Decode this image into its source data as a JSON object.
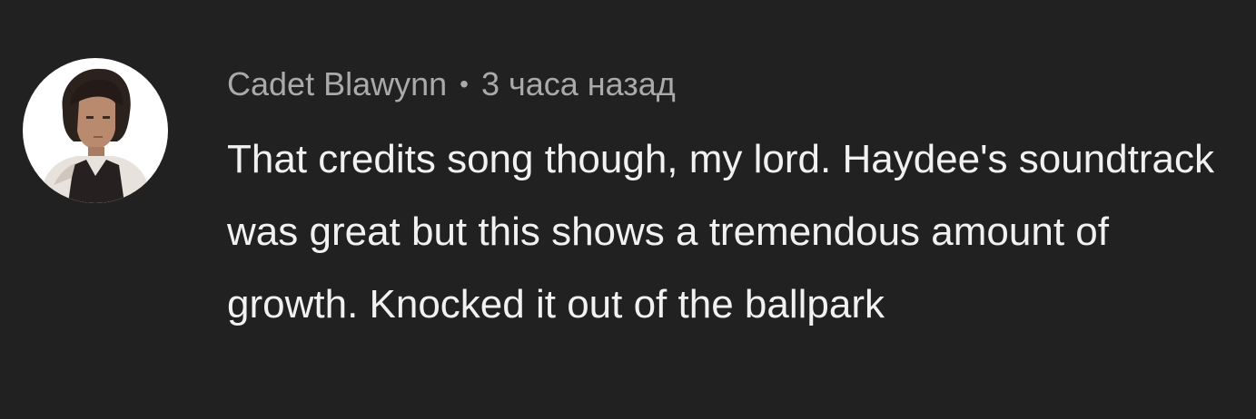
{
  "comment": {
    "author": "Cadet Blawynn",
    "separator": "•",
    "timestamp": "3 часа назад",
    "text": "That credits song though, my lord. Haydee's soundtrack was great but this shows a tremendous amount of growth. Knocked it out of the ballpark",
    "avatar_icon": "user-avatar"
  },
  "colors": {
    "background": "#212121",
    "meta_text": "#aaaaaa",
    "body_text": "#f1f1f1",
    "avatar_background": "#ffffff"
  }
}
